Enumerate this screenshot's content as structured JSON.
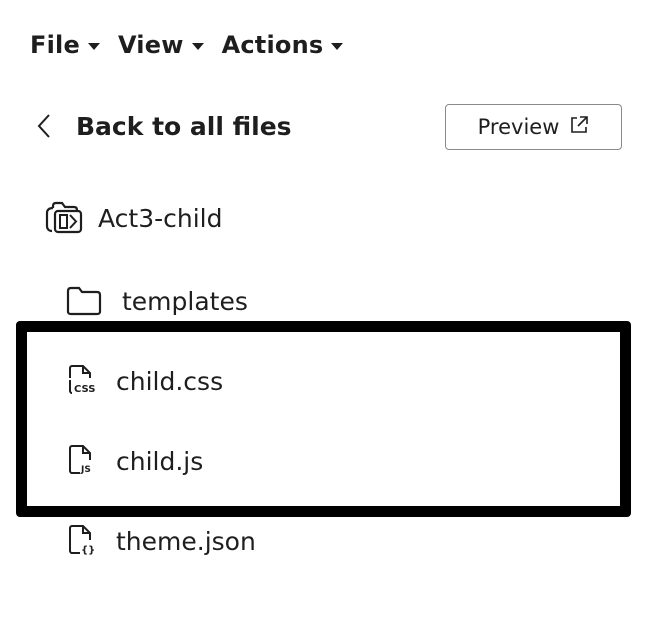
{
  "menubar": {
    "items": [
      {
        "label": "File",
        "icon": "caret-down-icon"
      },
      {
        "label": "View",
        "icon": "caret-down-icon"
      },
      {
        "label": "Actions",
        "icon": "caret-down-icon"
      }
    ]
  },
  "header": {
    "back_label": "Back to all files",
    "back_icon": "chevron-left-icon",
    "preview_label": "Preview",
    "preview_icon": "external-link-icon"
  },
  "file_tree": {
    "root": {
      "label": "Act3-child",
      "icon": "theme-folder-icon"
    },
    "children": [
      {
        "label": "templates",
        "icon": "folder-icon",
        "type": "folder"
      },
      {
        "label": "child.css",
        "icon": "css-file-icon",
        "type": "file",
        "highlighted": true
      },
      {
        "label": "child.js",
        "icon": "js-file-icon",
        "type": "file",
        "highlighted": true
      },
      {
        "label": "theme.json",
        "icon": "json-file-icon",
        "type": "file",
        "highlighted": false
      }
    ]
  },
  "colors": {
    "text": "#1e1e1e",
    "border": "#8a8a8a",
    "highlight": "#000000",
    "background": "#ffffff"
  }
}
